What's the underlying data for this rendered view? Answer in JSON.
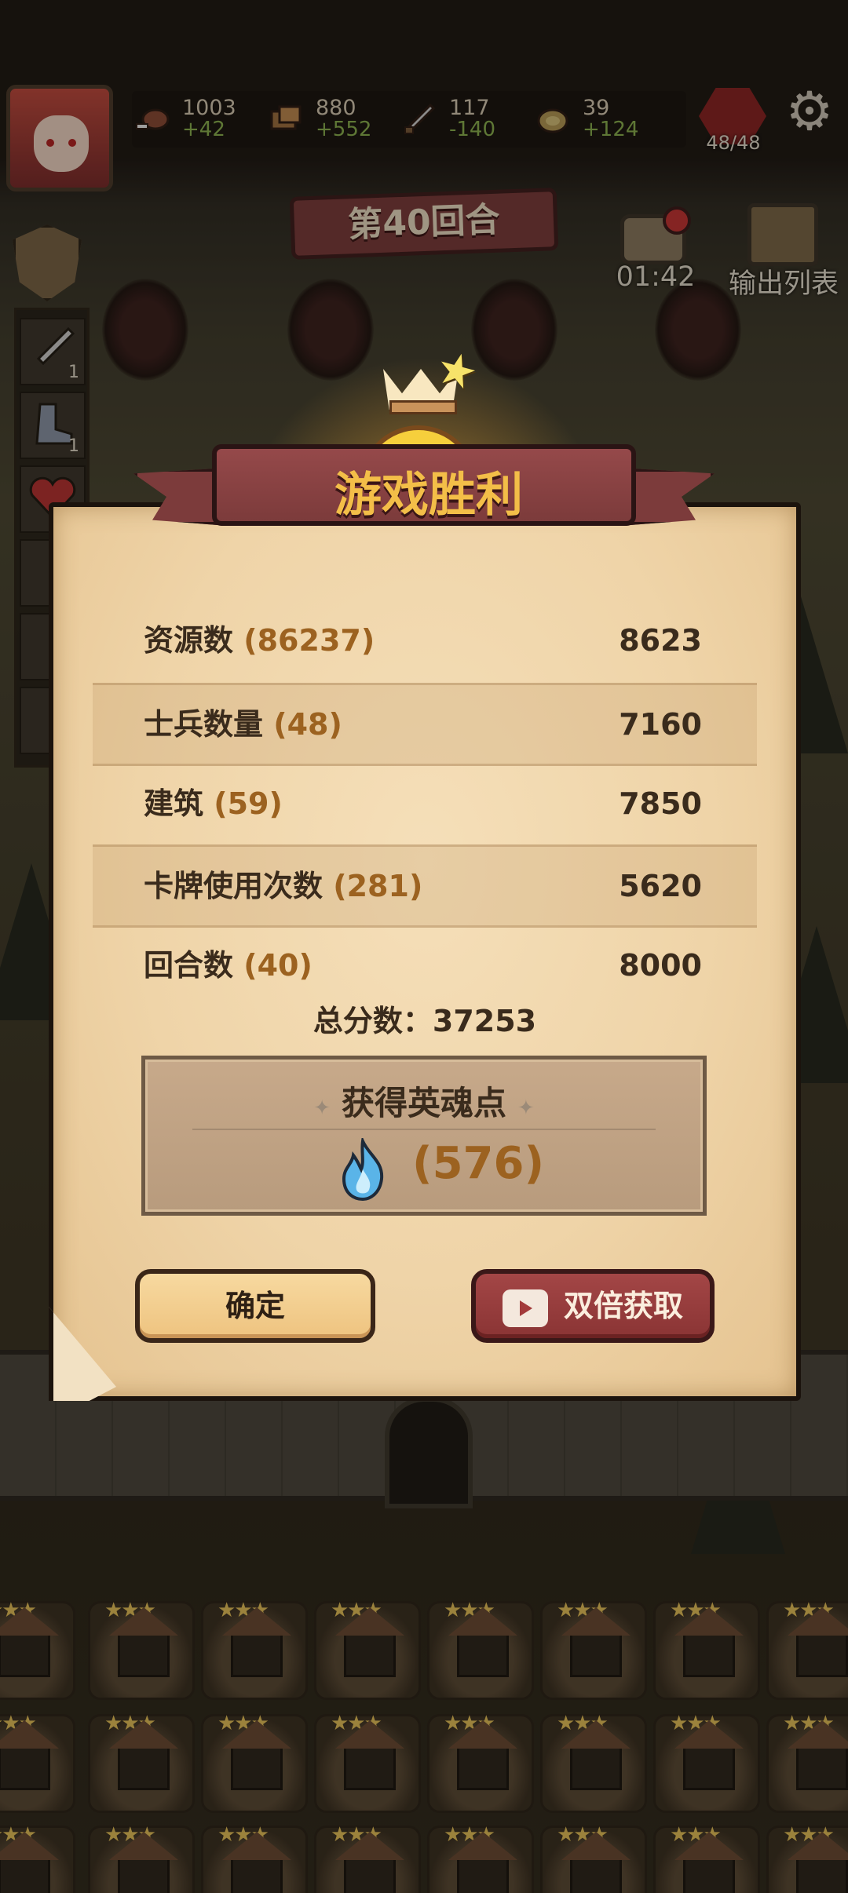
{
  "resources": [
    {
      "icon": "meat-icon",
      "value": "1003",
      "delta": "+42"
    },
    {
      "icon": "wood-icon",
      "value": "880",
      "delta": "+552"
    },
    {
      "icon": "sword-icon",
      "value": "117",
      "delta": "-140"
    },
    {
      "icon": "stone-icon",
      "value": "39",
      "delta": "+124"
    }
  ],
  "population": "48/48",
  "round_banner": "第40回合",
  "timer": "01:42",
  "output_list_label": "输出列表",
  "side_items": [
    {
      "icon": "sword-card-icon",
      "count": "1"
    },
    {
      "icon": "boot-card-icon",
      "count": "1"
    },
    {
      "icon": "heart-card-icon",
      "count": ""
    }
  ],
  "dialog": {
    "title": "游戏胜利",
    "rows": [
      {
        "label": "资源数",
        "count": "(86237)",
        "points": "8623"
      },
      {
        "label": "士兵数量",
        "count": "(48)",
        "points": "7160"
      },
      {
        "label": "建筑",
        "count": "(59)",
        "points": "7850"
      },
      {
        "label": "卡牌使用次数",
        "count": "(281)",
        "points": "5620"
      },
      {
        "label": "回合数",
        "count": "(40)",
        "points": "8000"
      }
    ],
    "total": "总分数：37253",
    "soul_title": "获得英魂点",
    "soul_value": "(576)",
    "confirm_label": "确定",
    "double_label": "双倍获取"
  },
  "colors": {
    "accent_gold": "#f3be48",
    "ribbon_red": "#7c3b3b",
    "value_brown": "#9c6220",
    "delta_green": "#8bb34f"
  }
}
